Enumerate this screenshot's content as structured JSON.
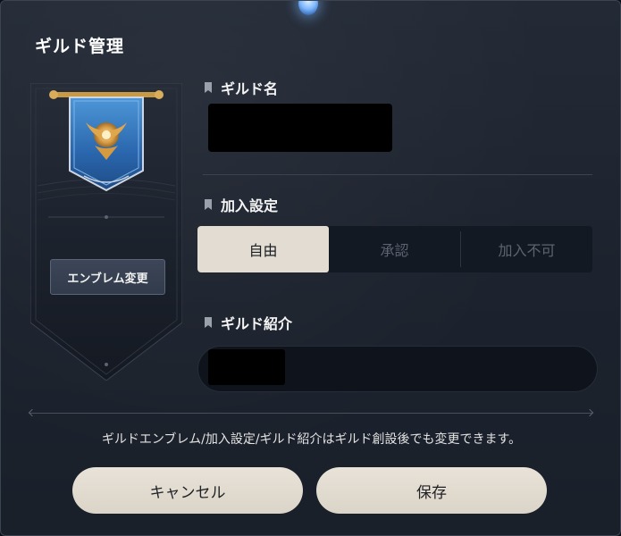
{
  "dialog": {
    "title": "ギルド管理"
  },
  "emblem": {
    "change_button_label": "エンブレム変更",
    "colors": {
      "banner_blue": "#2f6fb6",
      "crest_gold": "#d89a3a",
      "rod_gold": "#c99a45"
    }
  },
  "guild_name": {
    "label": "ギルド名",
    "value": ""
  },
  "join_setting": {
    "label": "加入設定",
    "options": [
      "自由",
      "承認",
      "加入不可"
    ],
    "selected": "自由"
  },
  "guild_intro": {
    "label": "ギルド紹介",
    "value": ""
  },
  "notice": "ギルドエンブレム/加入設定/ギルド紹介はギルド創設後でも変更できます。",
  "buttons": {
    "cancel": "キャンセル",
    "save": "保存"
  },
  "icons": [
    "bookmark-icon",
    "guild-emblem-icon"
  ]
}
